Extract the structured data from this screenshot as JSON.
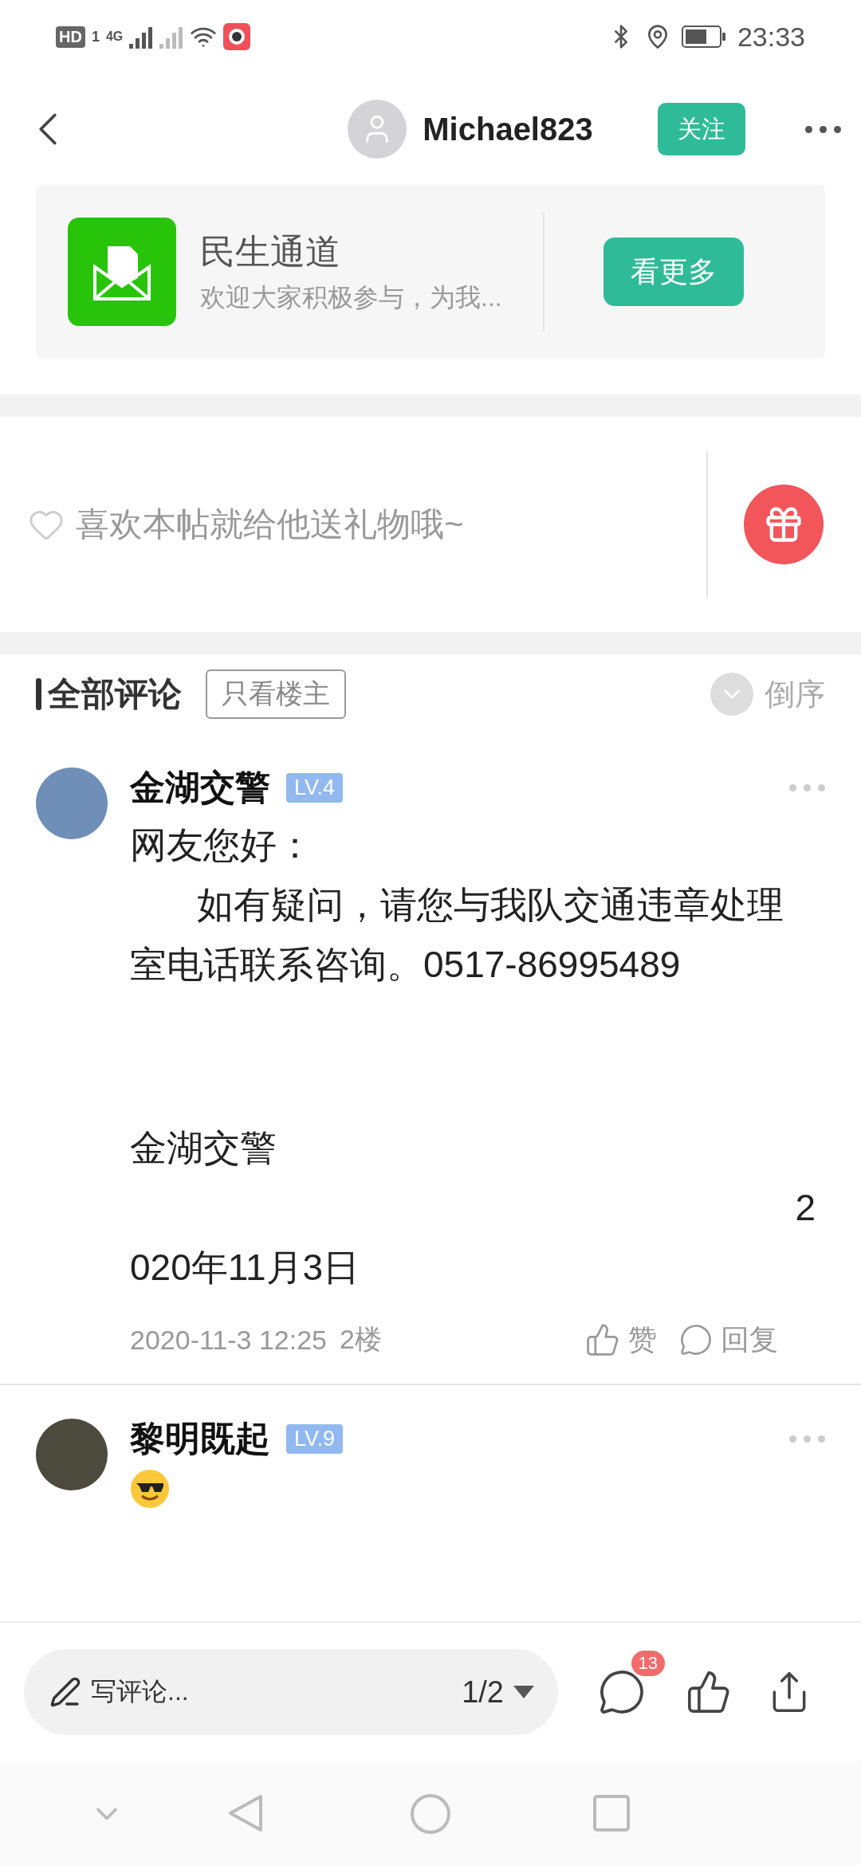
{
  "status_bar": {
    "hd": "HD",
    "sim": "1",
    "network": "4G",
    "time": "23:33"
  },
  "header": {
    "username": "Michael823",
    "follow": "关注"
  },
  "banner": {
    "title": "民生通道",
    "subtitle": "欢迎大家积极参与，为我...",
    "button": "看更多"
  },
  "gift": {
    "prompt": "喜欢本帖就给他送礼物哦~"
  },
  "comments_header": {
    "title": "全部评论",
    "filter": "只看楼主",
    "sort": "倒序"
  },
  "comments": [
    {
      "name": "金湖交警",
      "level": "LV.4",
      "paragraphs": [
        {
          "kind": "text",
          "text": "网友您好："
        },
        {
          "kind": "indent",
          "text": "如有疑问，请您与我队交通违章处理室电话联系咨询。0517-86995489"
        },
        {
          "kind": "signature",
          "text": "金湖交警"
        },
        {
          "kind": "right",
          "text": "2"
        },
        {
          "kind": "text",
          "text": "020年11月3日"
        }
      ],
      "time": "2020-11-3 12:25",
      "floor": "2楼",
      "like": "赞",
      "reply": "回复"
    },
    {
      "name": "黎明既起",
      "level": "LV.9",
      "paragraphs": [
        {
          "kind": "emoji"
        }
      ]
    }
  ],
  "bottom_bar": {
    "placeholder": "写评论...",
    "page": "1/2",
    "comment_count": "13"
  }
}
